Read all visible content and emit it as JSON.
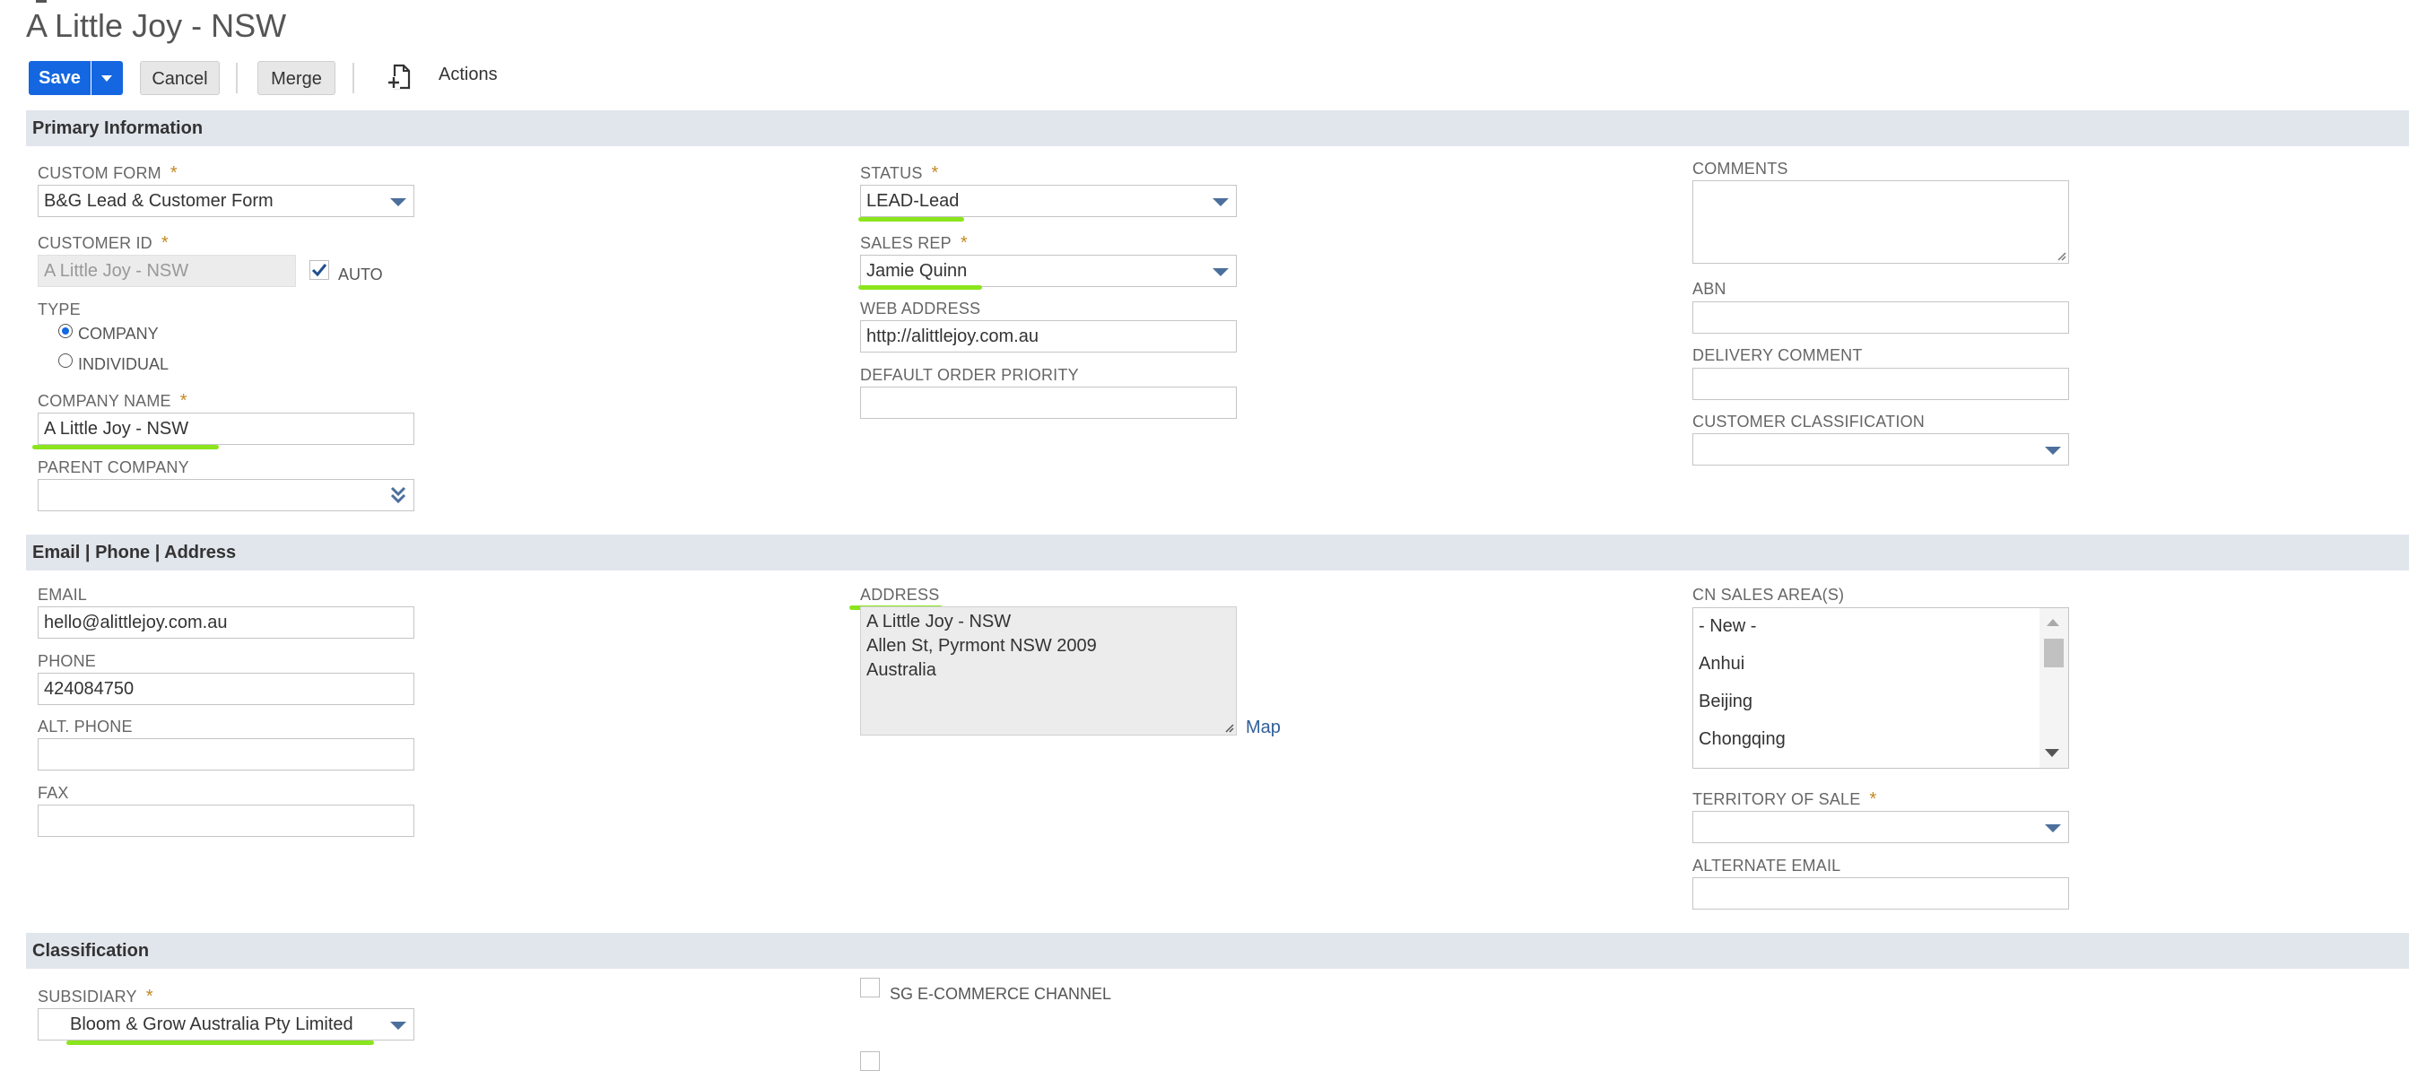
{
  "page": {
    "title": "A Little Joy - NSW"
  },
  "toolbar": {
    "save_label": "Save",
    "cancel_label": "Cancel",
    "merge_label": "Merge",
    "actions_label": "Actions"
  },
  "sections": {
    "primary": "Primary Information",
    "contact": "Email | Phone | Address",
    "classification": "Classification"
  },
  "primary": {
    "custom_form": {
      "label": "CUSTOM FORM",
      "required": "*",
      "value": "B&G Lead & Customer Form"
    },
    "customer_id": {
      "label": "CUSTOMER ID",
      "required": "*",
      "value": "A Little Joy - NSW",
      "auto_label": "AUTO",
      "auto_checked": true
    },
    "type": {
      "label": "TYPE",
      "options": [
        "COMPANY",
        "INDIVIDUAL"
      ],
      "selected": "COMPANY"
    },
    "company_name": {
      "label": "COMPANY NAME",
      "required": "*",
      "value": "A Little Joy - NSW"
    },
    "parent_company": {
      "label": "PARENT COMPANY",
      "value": ""
    },
    "status": {
      "label": "STATUS",
      "required": "*",
      "value": "LEAD-Lead"
    },
    "sales_rep": {
      "label": "SALES REP",
      "required": "*",
      "value": "Jamie Quinn"
    },
    "web_address": {
      "label": "WEB ADDRESS",
      "value": "http://alittlejoy.com.au"
    },
    "default_order_priority": {
      "label": "DEFAULT ORDER PRIORITY",
      "value": ""
    },
    "comments": {
      "label": "COMMENTS",
      "value": ""
    },
    "abn": {
      "label": "ABN",
      "value": ""
    },
    "delivery_comment": {
      "label": "DELIVERY COMMENT",
      "value": ""
    },
    "customer_classification": {
      "label": "CUSTOMER CLASSIFICATION",
      "value": ""
    }
  },
  "contact": {
    "email": {
      "label": "EMAIL",
      "value": "hello@alittlejoy.com.au"
    },
    "phone": {
      "label": "PHONE",
      "value": "424084750"
    },
    "alt_phone": {
      "label": "ALT. PHONE",
      "value": ""
    },
    "fax": {
      "label": "FAX",
      "value": ""
    },
    "address": {
      "label": "ADDRESS",
      "lines": [
        "A Little Joy - NSW",
        "Allen St, Pyrmont NSW 2009",
        "Australia"
      ],
      "map_label": "Map"
    },
    "cn_sales_areas": {
      "label": "CN SALES AREA(S)",
      "options": [
        "- New -",
        "Anhui",
        "Beijing",
        "Chongqing"
      ]
    },
    "territory_of_sale": {
      "label": "TERRITORY OF SALE",
      "required": "*",
      "value": ""
    },
    "alternate_email": {
      "label": "ALTERNATE EMAIL",
      "value": ""
    }
  },
  "classification": {
    "subsidiary": {
      "label": "SUBSIDIARY",
      "required": "*",
      "value": "Bloom & Grow Australia Pty Limited"
    },
    "sg_ecommerce_channel": {
      "label": "SG E-COMMERCE CHANNEL",
      "checked": false
    }
  },
  "colors": {
    "primary_button": "#1467e0",
    "section_bar": "#e1e5ec",
    "highlight": "#8be51c",
    "required_star": "#c28a24",
    "link": "#2f5f98"
  },
  "icons": {
    "actions": "document-plus-icon",
    "dropdown": "caret-down-icon",
    "popup_select": "double-chevron-down-icon",
    "checkbox": "checkmark-icon"
  }
}
